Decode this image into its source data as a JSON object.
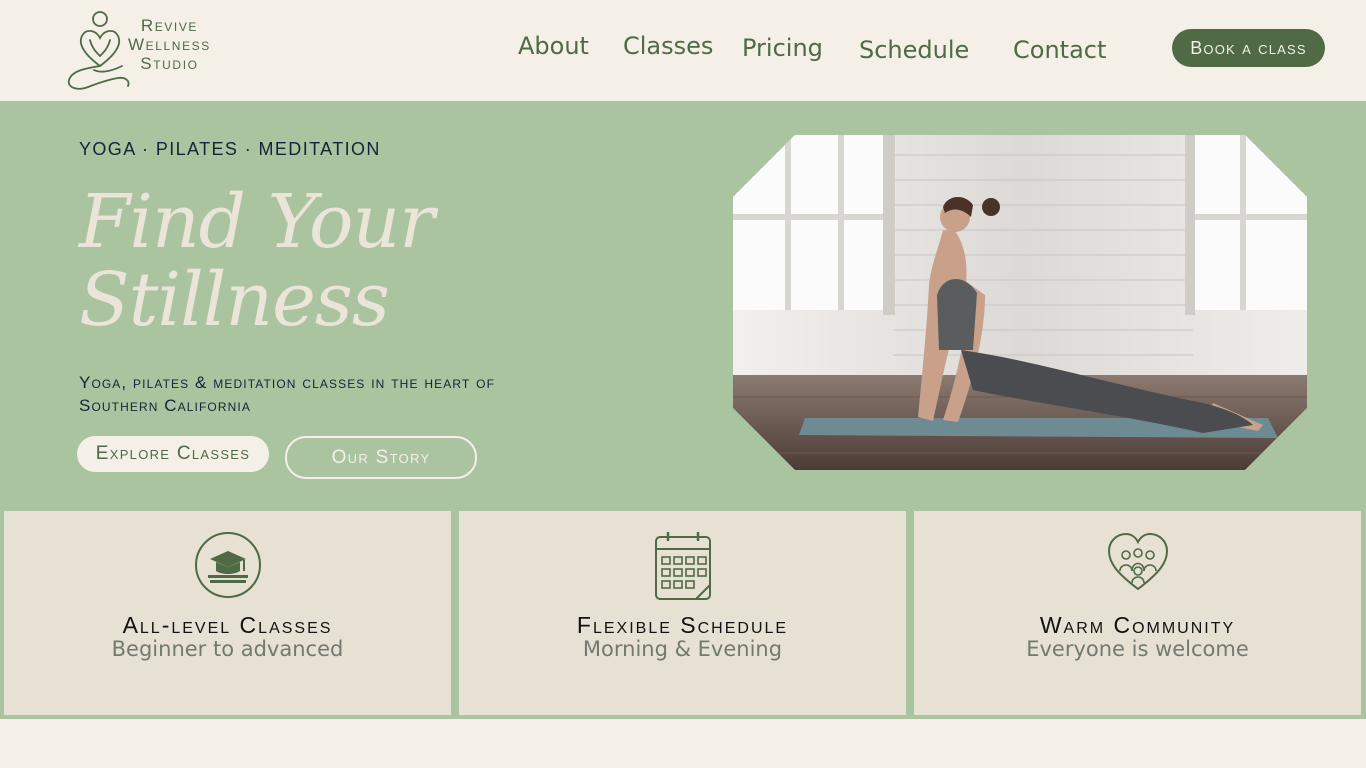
{
  "header": {
    "logo_lines": [
      "Revive",
      "Wellness",
      "Studio"
    ],
    "nav": [
      "About",
      "Classes",
      "Pricing",
      "Schedule",
      "Contact"
    ],
    "book_label": "Book a class"
  },
  "hero": {
    "eyebrow": "YOGA · PILATES · MEDITATION",
    "headline_lines": [
      "Find Your",
      "Stillness"
    ],
    "subtext": "Yoga, pilates & meditation classes in the heart of Southern California",
    "primary_cta": "Explore Classes",
    "secondary_cta": "Our Story"
  },
  "features": [
    {
      "title": "All-level Classes",
      "subtitle": "Beginner to advanced",
      "icon": "graduation-cap-icon"
    },
    {
      "title": "Flexible Schedule",
      "subtitle": "Morning & Evening",
      "icon": "calendar-icon"
    },
    {
      "title": "Warm Community",
      "subtitle": "Everyone is welcome",
      "icon": "heart-people-icon"
    }
  ],
  "colors": {
    "brand_green": "#4f6a44",
    "hero_sage": "#a9c49f",
    "cream": "#f4f0e8",
    "card_beige": "#e7e1d3"
  }
}
